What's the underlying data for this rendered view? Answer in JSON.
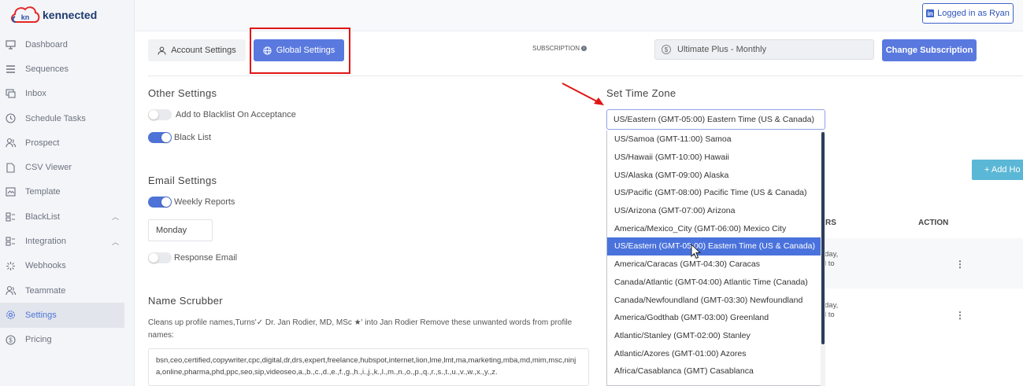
{
  "app": {
    "brand": "kennected",
    "logo_mark": "kn"
  },
  "sidebar": {
    "items": [
      {
        "label": "Dashboard",
        "icon": "monitor-icon"
      },
      {
        "label": "Sequences",
        "icon": "sequence-icon"
      },
      {
        "label": "Inbox",
        "icon": "inbox-icon"
      },
      {
        "label": "Schedule Tasks",
        "icon": "clock-icon"
      },
      {
        "label": "Prospect",
        "icon": "users-icon"
      },
      {
        "label": "CSV Viewer",
        "icon": "file-icon"
      },
      {
        "label": "Template",
        "icon": "template-icon"
      },
      {
        "label": "BlackList",
        "icon": "list-icon"
      },
      {
        "label": "Integration",
        "icon": "integration-icon"
      },
      {
        "label": "Webhooks",
        "icon": "webhooks-icon"
      },
      {
        "label": "Teammate",
        "icon": "user-icon"
      },
      {
        "label": "Settings",
        "icon": "gear-icon"
      },
      {
        "label": "Pricing",
        "icon": "dollar-icon"
      }
    ],
    "active": "Settings"
  },
  "header": {
    "logged_in": "Logged in as Ryan"
  },
  "tabs": {
    "account": "Account Settings",
    "global": "Global Settings"
  },
  "subscription": {
    "label": "SUBSCRIPTION",
    "value": "Ultimate Plus - Monthly",
    "change_button": "Change Subscription"
  },
  "other_settings": {
    "title": "Other Settings",
    "blacklist_on_acceptance": {
      "label": "Add to Blacklist On Acceptance",
      "on": false
    },
    "black_list": {
      "label": "Black List",
      "on": true
    }
  },
  "email_settings": {
    "title": "Email Settings",
    "weekly_reports": {
      "label": "Weekly Reports",
      "on": true
    },
    "day": "Monday",
    "response_email": {
      "label": "Response Email",
      "on": false
    }
  },
  "name_scrubber": {
    "title": "Name Scrubber",
    "description": "Cleans up profile names,Turns'✓ Dr. Jan Rodier, MD, MSc ★' into Jan Rodier Remove these unwanted words from profile names:",
    "words": "bsn,ceo,certified,copywriter,cpc,digital,dr,drs,expert,freelance,hubspot,internet,lion,lme,lmt,ma,marketing,mba,md,mim,msc,ninja,online,pharma,phd,ppc,seo,sip,videoseo,a.,b.,c.,d.,e.,f.,g.,h.,i.,j.,k.,l.,m.,n.,o.,p.,q.,r.,s.,t.,u.,v.,w.,x.,y.,z."
  },
  "timezone": {
    "title": "Set Time Zone",
    "selected": "US/Eastern (GMT-05:00) Eastern Time (US & Canada)",
    "options": [
      "US/Samoa (GMT-11:00) Samoa",
      "US/Hawaii (GMT-10:00) Hawaii",
      "US/Alaska (GMT-09:00) Alaska",
      "US/Pacific (GMT-08:00) Pacific Time (US & Canada)",
      "US/Arizona (GMT-07:00) Arizona",
      "America/Mexico_City (GMT-06:00) Mexico City",
      "US/Eastern (GMT-05:00) Eastern Time (US & Canada)",
      "America/Caracas (GMT-04:30) Caracas",
      "Canada/Atlantic (GMT-04:00) Atlantic Time (Canada)",
      "Canada/Newfoundland (GMT-03:30) Newfoundland",
      "America/Godthab (GMT-03:00) Greenland",
      "Atlantic/Stanley (GMT-02:00) Stanley",
      "Atlantic/Azores (GMT-01:00) Azores",
      "Africa/Casablanca (GMT) Casablanca"
    ],
    "highlighted_index": 6
  },
  "hours": {
    "add_button": "+ Add Ho",
    "columns": {
      "hours_partial": "RS",
      "action": "ACTION"
    },
    "rows": [
      {
        "line1": "day,",
        "line2": "l to"
      },
      {
        "line1": "day,",
        "line2": "l to"
      }
    ]
  },
  "colors": {
    "primary": "#5a79df",
    "annotation_red": "#e01616",
    "add_button": "#5bb7d6",
    "selected_option": "#4a72dc"
  }
}
